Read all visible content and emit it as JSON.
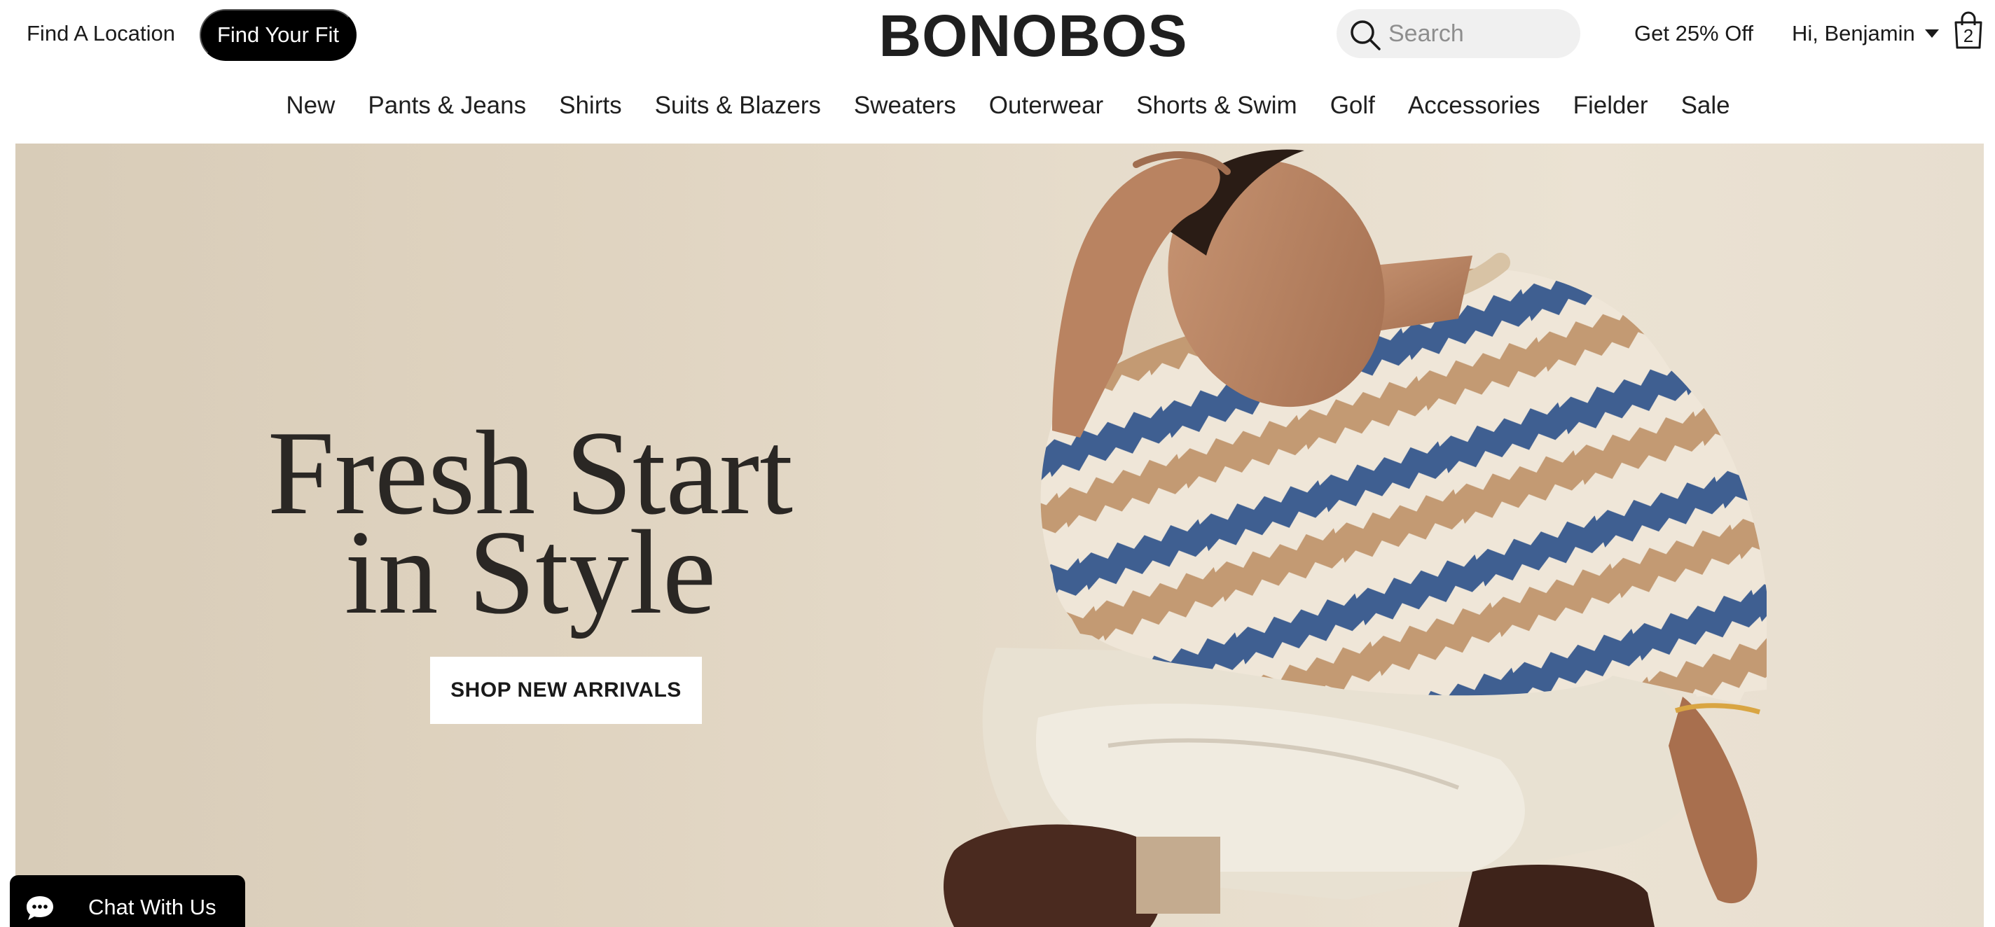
{
  "header": {
    "find_location": "Find A Location",
    "find_fit": "Find Your Fit",
    "logo": "BONOBOS",
    "search": {
      "placeholder": "Search",
      "value": ""
    },
    "promo": "Get 25% Off",
    "greeting": "Hi, Benjamin",
    "bag_count": "2"
  },
  "nav": {
    "items": [
      "New",
      "Pants & Jeans",
      "Shirts",
      "Suits & Blazers",
      "Sweaters",
      "Outerwear",
      "Shorts & Swim",
      "Golf",
      "Accessories",
      "Fielder",
      "Sale"
    ]
  },
  "hero": {
    "headline_line1": "Fresh Start",
    "headline_line2": "in Style",
    "cta": "SHOP NEW ARRIVALS"
  },
  "chat": {
    "label": "Chat With Us"
  },
  "colors": {
    "hero_background": "#e3d8c6",
    "button_dark": "#000000",
    "search_bg": "#f0f0f0",
    "sweater_blue": "#3f5f91",
    "sweater_tan": "#c39a73"
  },
  "icons": {
    "search": "search-icon",
    "caret": "caret-down-icon",
    "bag": "shopping-bag-icon",
    "chat": "chat-bubble-icon"
  }
}
